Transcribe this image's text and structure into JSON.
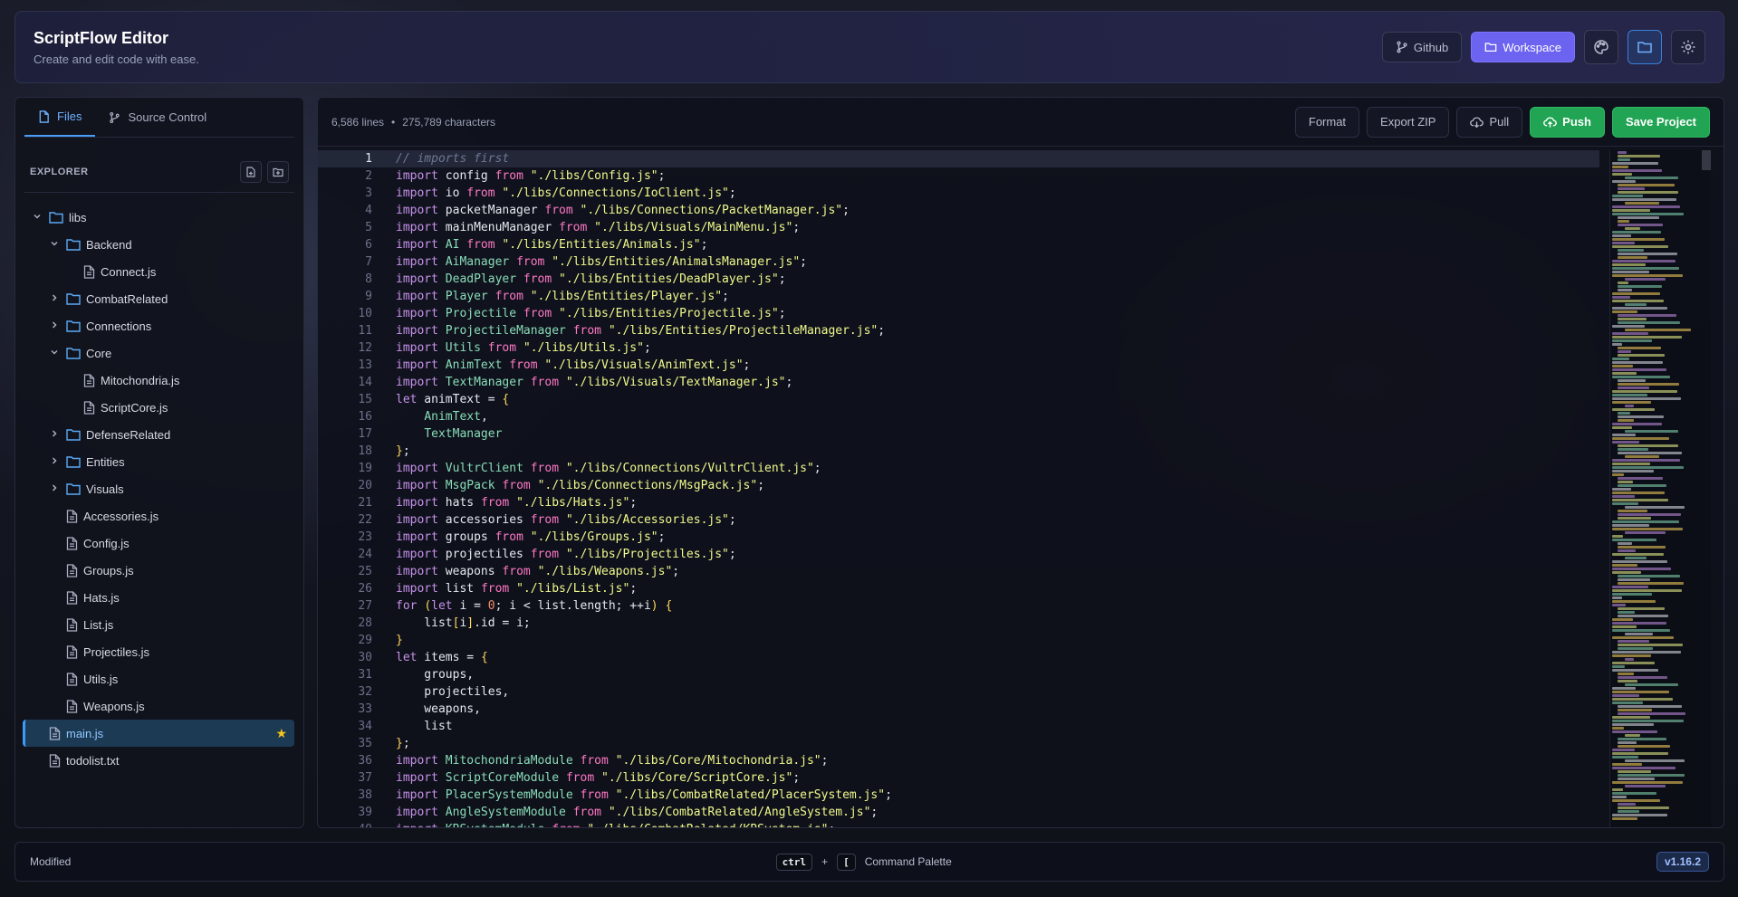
{
  "header": {
    "title": "ScriptFlow Editor",
    "subtitle": "Create and edit code with ease.",
    "github_label": "Github",
    "workspace_label": "Workspace"
  },
  "sidebar": {
    "tabs": [
      {
        "label": "Files"
      },
      {
        "label": "Source Control"
      }
    ],
    "explorer_label": "EXPLORER"
  },
  "tree": [
    {
      "label": "libs",
      "type": "folder",
      "depth": 0,
      "open": true
    },
    {
      "label": "Backend",
      "type": "folder",
      "depth": 1,
      "open": true
    },
    {
      "label": "Connect.js",
      "type": "file",
      "depth": 2
    },
    {
      "label": "CombatRelated",
      "type": "folder",
      "depth": 1,
      "open": false
    },
    {
      "label": "Connections",
      "type": "folder",
      "depth": 1,
      "open": false
    },
    {
      "label": "Core",
      "type": "folder",
      "depth": 1,
      "open": true
    },
    {
      "label": "Mitochondria.js",
      "type": "file",
      "depth": 2
    },
    {
      "label": "ScriptCore.js",
      "type": "file",
      "depth": 2
    },
    {
      "label": "DefenseRelated",
      "type": "folder",
      "depth": 1,
      "open": false
    },
    {
      "label": "Entities",
      "type": "folder",
      "depth": 1,
      "open": false
    },
    {
      "label": "Visuals",
      "type": "folder",
      "depth": 1,
      "open": false
    },
    {
      "label": "Accessories.js",
      "type": "file",
      "depth": 1
    },
    {
      "label": "Config.js",
      "type": "file",
      "depth": 1
    },
    {
      "label": "Groups.js",
      "type": "file",
      "depth": 1
    },
    {
      "label": "Hats.js",
      "type": "file",
      "depth": 1
    },
    {
      "label": "List.js",
      "type": "file",
      "depth": 1
    },
    {
      "label": "Projectiles.js",
      "type": "file",
      "depth": 1
    },
    {
      "label": "Utils.js",
      "type": "file",
      "depth": 1
    },
    {
      "label": "Weapons.js",
      "type": "file",
      "depth": 1
    },
    {
      "label": "main.js",
      "type": "file",
      "depth": 0,
      "selected": true,
      "starred": true
    },
    {
      "label": "todolist.txt",
      "type": "file",
      "depth": 0
    }
  ],
  "editor": {
    "lines_count": "6,586 lines",
    "chars_count": "275,789 characters",
    "format_label": "Format",
    "export_label": "Export ZIP",
    "pull_label": "Pull",
    "push_label": "Push",
    "save_label": "Save Project",
    "current_line": 1,
    "code": [
      "// imports first",
      "import config from \"./libs/Config.js\";",
      "import io from \"./libs/Connections/IoClient.js\";",
      "import packetManager from \"./libs/Connections/PacketManager.js\";",
      "import mainMenuManager from \"./libs/Visuals/MainMenu.js\";",
      "import AI from \"./libs/Entities/Animals.js\";",
      "import AiManager from \"./libs/Entities/AnimalsManager.js\";",
      "import DeadPlayer from \"./libs/Entities/DeadPlayer.js\";",
      "import Player from \"./libs/Entities/Player.js\";",
      "import Projectile from \"./libs/Entities/Projectile.js\";",
      "import ProjectileManager from \"./libs/Entities/ProjectileManager.js\";",
      "import Utils from \"./libs/Utils.js\";",
      "import AnimText from \"./libs/Visuals/AnimText.js\";",
      "import TextManager from \"./libs/Visuals/TextManager.js\";",
      "let animText = {",
      "    AnimText,",
      "    TextManager",
      "};",
      "import VultrClient from \"./libs/Connections/VultrClient.js\";",
      "import MsgPack from \"./libs/Connections/MsgPack.js\";",
      "import hats from \"./libs/Hats.js\";",
      "import accessories from \"./libs/Accessories.js\";",
      "import groups from \"./libs/Groups.js\";",
      "import projectiles from \"./libs/Projectiles.js\";",
      "import weapons from \"./libs/Weapons.js\";",
      "import list from \"./libs/List.js\";",
      "for (let i = 0; i < list.length; ++i) {",
      "    list[i].id = i;",
      "}",
      "let items = {",
      "    groups,",
      "    projectiles,",
      "    weapons,",
      "    list",
      "};",
      "import MitochondriaModule from \"./libs/Core/Mitochondria.js\";",
      "import ScriptCoreModule from \"./libs/Core/ScriptCore.js\";",
      "import PlacerSystemModule from \"./libs/CombatRelated/PlacerSystem.js\";",
      "import AngleSystemModule from \"./libs/CombatRelated/AngleSystem.js\";",
      "import KBSystemModule from \"./libs/CombatRelated/KBSystem.js\";"
    ]
  },
  "statusbar": {
    "status": "Modified",
    "key1": "ctrl",
    "plus": "+",
    "key2": "[",
    "command_label": "Command Palette",
    "version": "v1.16.2"
  },
  "colors": {
    "accent": "#6c63f0",
    "green": "#21a453",
    "selected": "#3a9cf7"
  }
}
